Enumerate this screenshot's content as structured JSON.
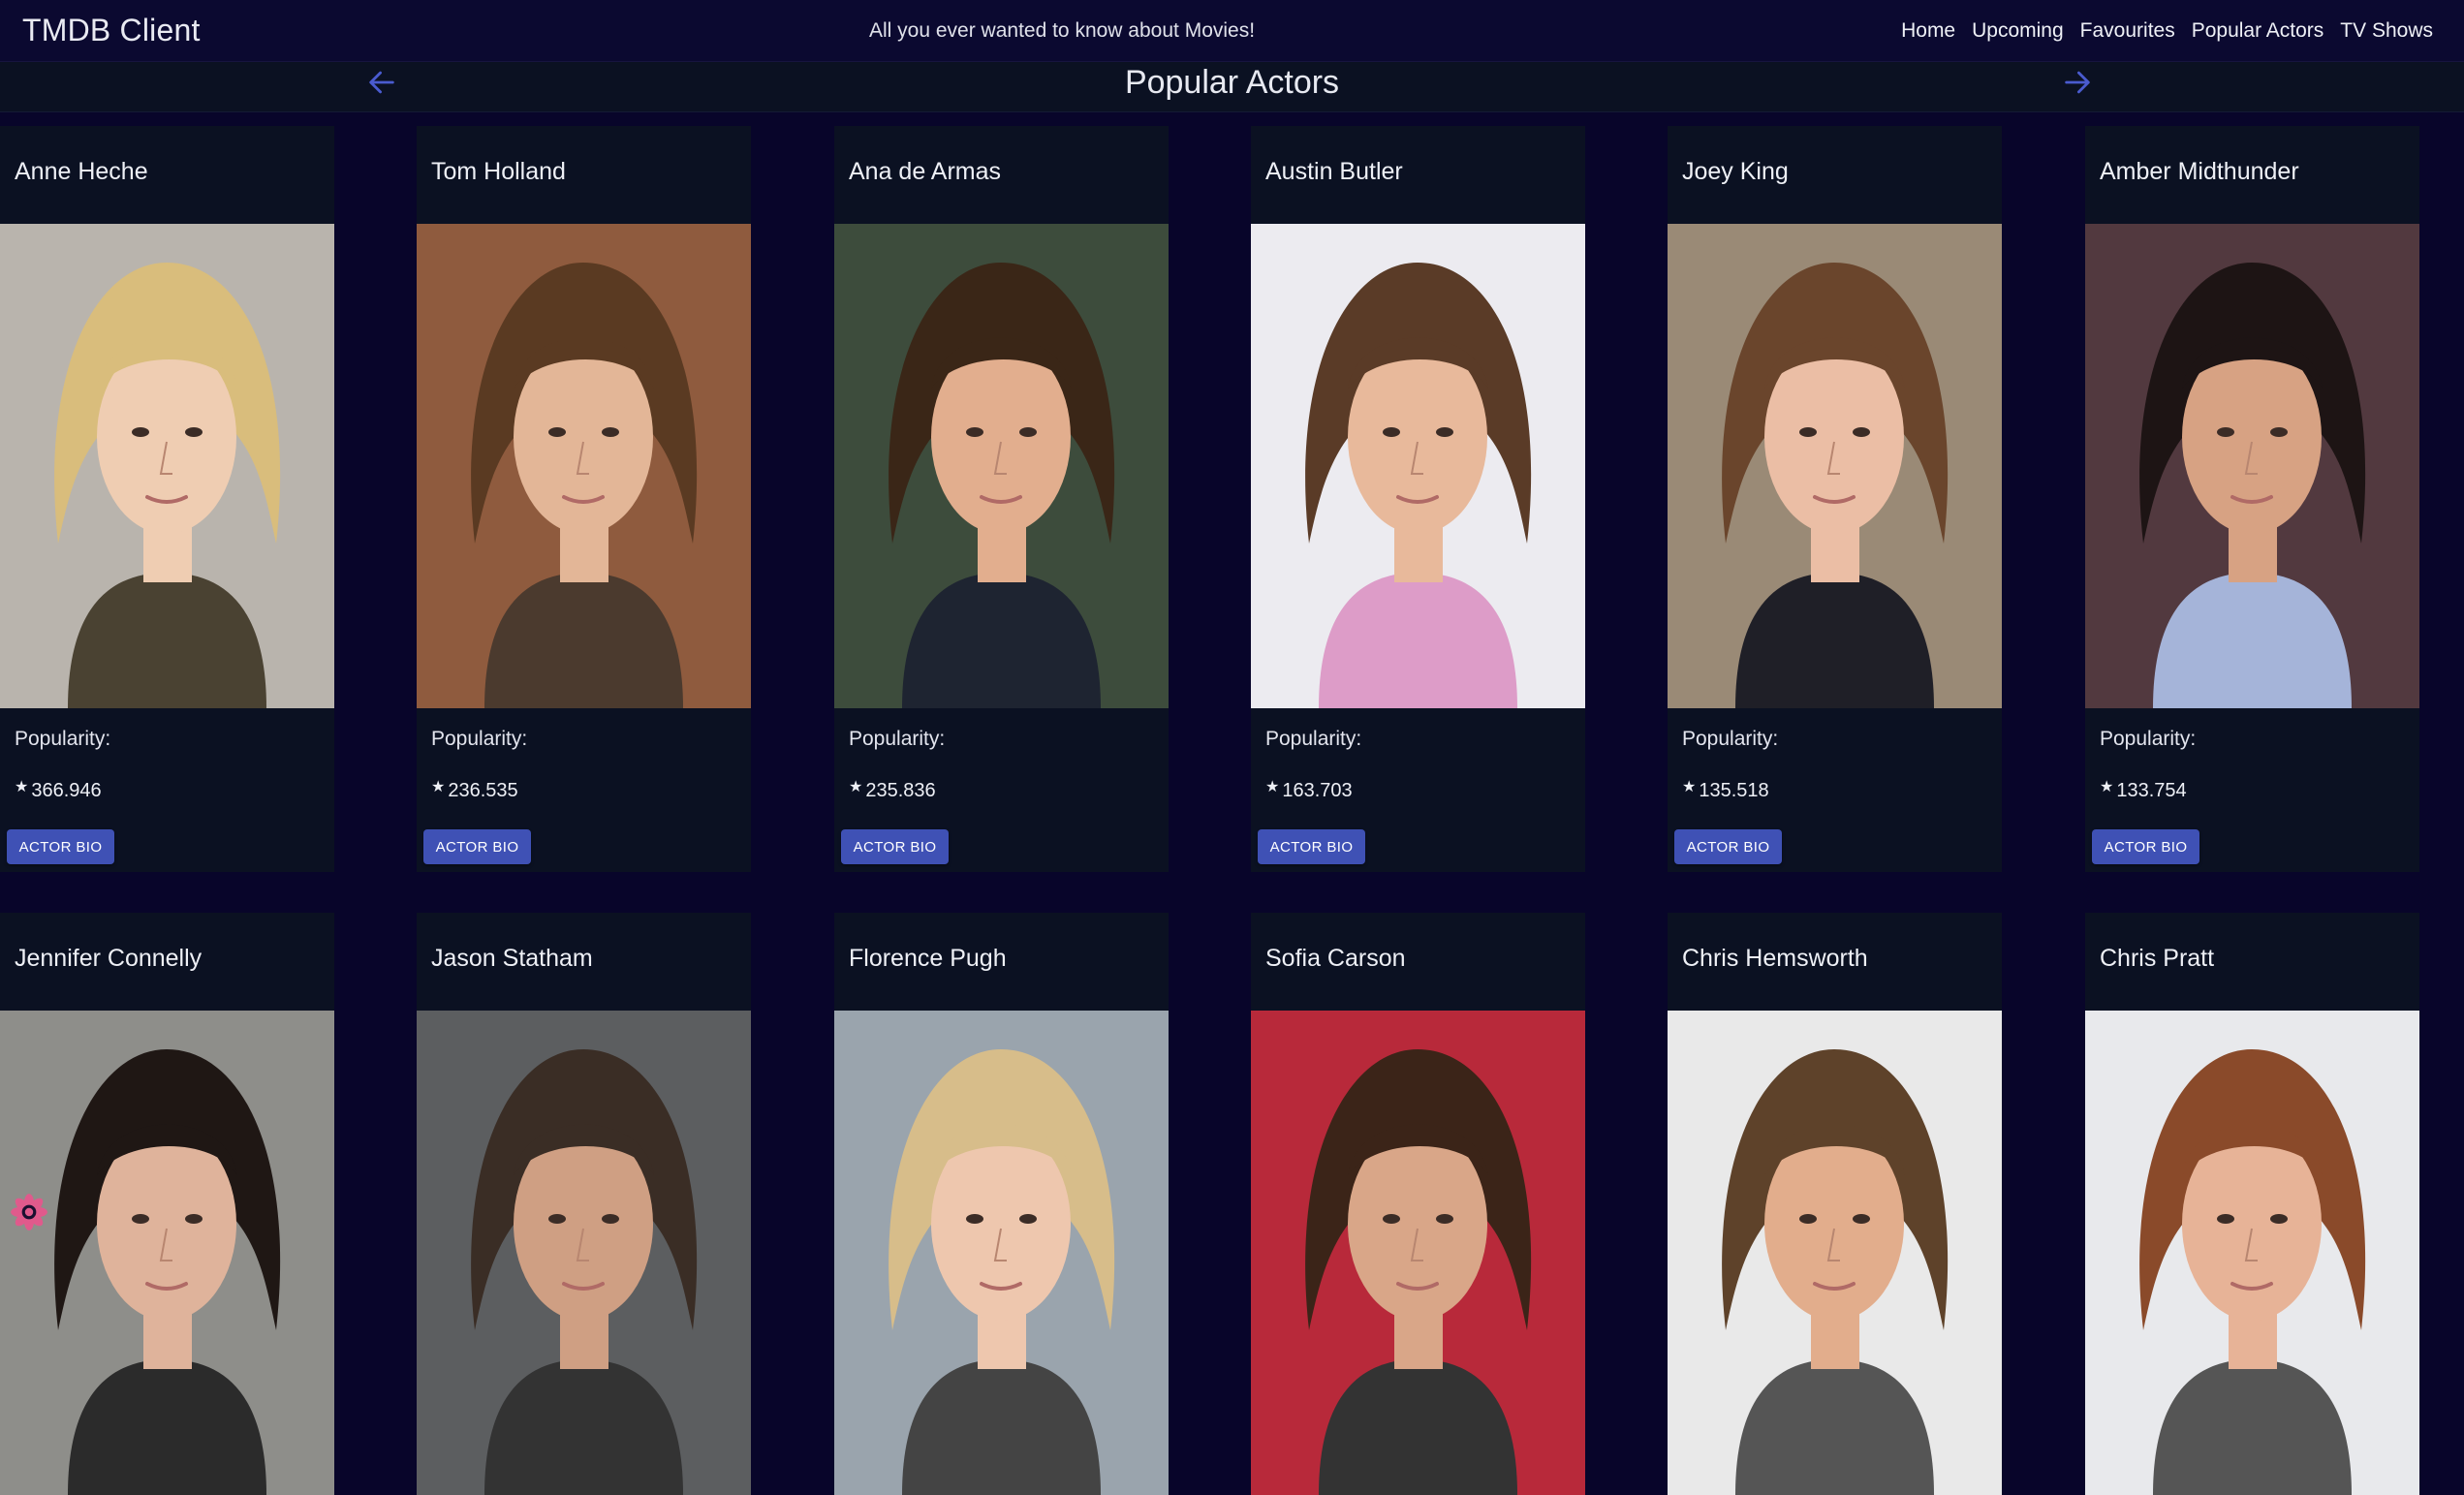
{
  "app": {
    "title": "TMDB Client",
    "tagline": "All you ever wanted to know about Movies!"
  },
  "nav": {
    "items": [
      "Home",
      "Upcoming",
      "Favourites",
      "Popular Actors",
      "TV Shows"
    ]
  },
  "page": {
    "title": "Popular Actors",
    "prev_icon": "arrow-left-icon",
    "next_icon": "arrow-right-icon"
  },
  "colors": {
    "background": "#08052a",
    "card": "#0b1122",
    "accent": "#3f51b5",
    "arrow": "#4a5bcf"
  },
  "labels": {
    "popularity": "Popularity:",
    "bio_button": "ACTOR BIO"
  },
  "actors": [
    {
      "name": "Anne Heche",
      "popularity": "366.946",
      "photo": {
        "bg": "#b9b4ad",
        "hair": "#d9bd7c",
        "skin": "#efcdb2",
        "shirt": "#4a4232"
      }
    },
    {
      "name": "Tom Holland",
      "popularity": "236.535",
      "photo": {
        "bg": "#8f5b3e",
        "hair": "#5a3a22",
        "skin": "#e3b697",
        "shirt": "#4b3a2e"
      }
    },
    {
      "name": "Ana de Armas",
      "popularity": "235.836",
      "photo": {
        "bg": "#3d4c3c",
        "hair": "#3a2617",
        "skin": "#e2ae8e",
        "shirt": "#1e2431"
      }
    },
    {
      "name": "Austin Butler",
      "popularity": "163.703",
      "photo": {
        "bg": "#ecebf0",
        "hair": "#5a3b27",
        "skin": "#e8b99b",
        "shirt": "#dd9cc8"
      }
    },
    {
      "name": "Joey King",
      "popularity": "135.518",
      "photo": {
        "bg": "#9a8a76",
        "hair": "#6a452c",
        "skin": "#ebbea5",
        "shirt": "#1f1f27"
      }
    },
    {
      "name": "Amber Midthunder",
      "popularity": "133.754",
      "photo": {
        "bg": "#52393f",
        "hair": "#1d1414",
        "skin": "#d7a283",
        "shirt": "#a5b4d9"
      }
    },
    {
      "name": "Jennifer Connelly",
      "popularity": "",
      "photo": {
        "bg": "#8e8e8a",
        "hair": "#1f1714",
        "skin": "#dfb39b",
        "shirt": "#2b2b2b"
      }
    },
    {
      "name": "Jason Statham",
      "popularity": "",
      "photo": {
        "bg": "#5c5e60",
        "hair": "#3a2d25",
        "skin": "#cf9f83",
        "shirt": "#333"
      }
    },
    {
      "name": "Florence Pugh",
      "popularity": "",
      "photo": {
        "bg": "#9aa4ad",
        "hair": "#d7bd8a",
        "skin": "#eec7ae",
        "shirt": "#444"
      }
    },
    {
      "name": "Sofia Carson",
      "popularity": "",
      "photo": {
        "bg": "#b8293a",
        "hair": "#3b2418",
        "skin": "#d9a688",
        "shirt": "#333"
      }
    },
    {
      "name": "Chris Hemsworth",
      "popularity": "",
      "photo": {
        "bg": "#e9e9e9",
        "hair": "#5e422a",
        "skin": "#e2ad8c",
        "shirt": "#555"
      }
    },
    {
      "name": "Chris Pratt",
      "popularity": "",
      "photo": {
        "bg": "#e8e9ec",
        "hair": "#8a4a2a",
        "skin": "#e7b397",
        "shirt": "#555"
      }
    }
  ]
}
